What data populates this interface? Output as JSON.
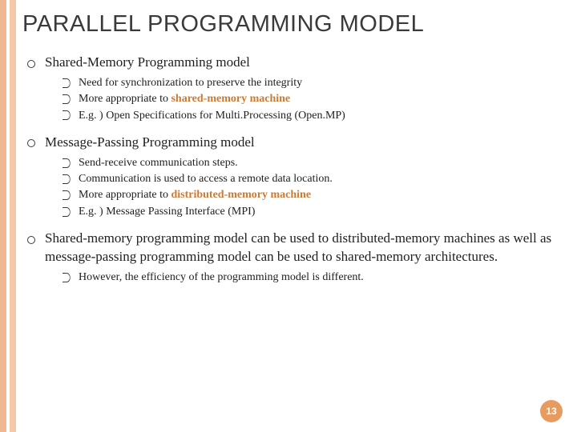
{
  "title": "PARALLEL PROGRAMMING MODEL",
  "sections": [
    {
      "heading": "Shared-Memory Programming model",
      "sub": [
        {
          "pre": "Need for synchronization to preserve the integrity",
          "hl": "",
          "post": ""
        },
        {
          "pre": "More appropriate to ",
          "hl": "shared-memory machine",
          "post": ""
        },
        {
          "pre": "E.g. ) Open Specifications for Multi.Processing (Open.MP)",
          "hl": "",
          "post": ""
        }
      ]
    },
    {
      "heading": "Message-Passing Programming model",
      "sub": [
        {
          "pre": "Send-receive communication steps.",
          "hl": "",
          "post": ""
        },
        {
          "pre": "Communication is used to access a remote data location.",
          "hl": "",
          "post": ""
        },
        {
          "pre": "More appropriate to ",
          "hl": "distributed-memory machine",
          "post": ""
        },
        {
          "pre": "E.g. ) Message Passing Interface (MPI)",
          "hl": "",
          "post": ""
        }
      ]
    },
    {
      "heading": "Shared-memory programming model can be used to distributed-memory machines as well as message-passing programming model can be used to shared-memory architectures.",
      "sub": [
        {
          "pre": "However, the efficiency of the programming model is different.",
          "hl": "",
          "post": ""
        }
      ]
    }
  ],
  "page_number": "13"
}
